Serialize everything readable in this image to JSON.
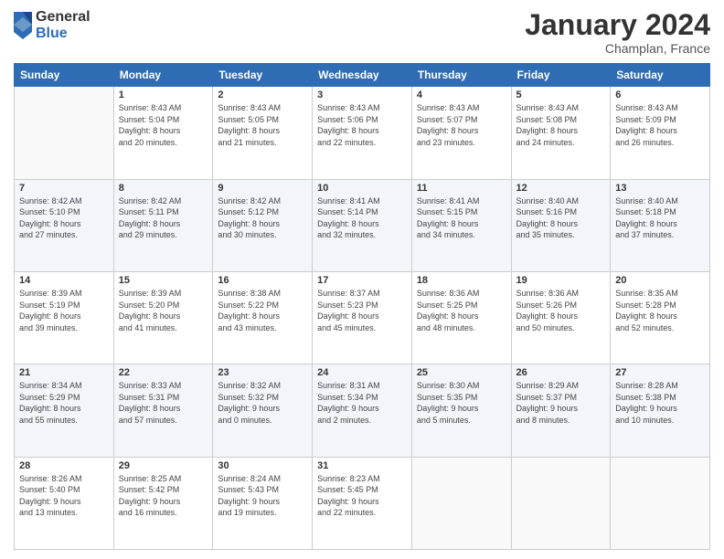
{
  "logo": {
    "general": "General",
    "blue": "Blue"
  },
  "header": {
    "month": "January 2024",
    "location": "Champlan, France"
  },
  "weekdays": [
    "Sunday",
    "Monday",
    "Tuesday",
    "Wednesday",
    "Thursday",
    "Friday",
    "Saturday"
  ],
  "weeks": [
    [
      {
        "day": "",
        "info": ""
      },
      {
        "day": "1",
        "info": "Sunrise: 8:43 AM\nSunset: 5:04 PM\nDaylight: 8 hours\nand 20 minutes."
      },
      {
        "day": "2",
        "info": "Sunrise: 8:43 AM\nSunset: 5:05 PM\nDaylight: 8 hours\nand 21 minutes."
      },
      {
        "day": "3",
        "info": "Sunrise: 8:43 AM\nSunset: 5:06 PM\nDaylight: 8 hours\nand 22 minutes."
      },
      {
        "day": "4",
        "info": "Sunrise: 8:43 AM\nSunset: 5:07 PM\nDaylight: 8 hours\nand 23 minutes."
      },
      {
        "day": "5",
        "info": "Sunrise: 8:43 AM\nSunset: 5:08 PM\nDaylight: 8 hours\nand 24 minutes."
      },
      {
        "day": "6",
        "info": "Sunrise: 8:43 AM\nSunset: 5:09 PM\nDaylight: 8 hours\nand 26 minutes."
      }
    ],
    [
      {
        "day": "7",
        "info": "Sunrise: 8:42 AM\nSunset: 5:10 PM\nDaylight: 8 hours\nand 27 minutes."
      },
      {
        "day": "8",
        "info": "Sunrise: 8:42 AM\nSunset: 5:11 PM\nDaylight: 8 hours\nand 29 minutes."
      },
      {
        "day": "9",
        "info": "Sunrise: 8:42 AM\nSunset: 5:12 PM\nDaylight: 8 hours\nand 30 minutes."
      },
      {
        "day": "10",
        "info": "Sunrise: 8:41 AM\nSunset: 5:14 PM\nDaylight: 8 hours\nand 32 minutes."
      },
      {
        "day": "11",
        "info": "Sunrise: 8:41 AM\nSunset: 5:15 PM\nDaylight: 8 hours\nand 34 minutes."
      },
      {
        "day": "12",
        "info": "Sunrise: 8:40 AM\nSunset: 5:16 PM\nDaylight: 8 hours\nand 35 minutes."
      },
      {
        "day": "13",
        "info": "Sunrise: 8:40 AM\nSunset: 5:18 PM\nDaylight: 8 hours\nand 37 minutes."
      }
    ],
    [
      {
        "day": "14",
        "info": "Sunrise: 8:39 AM\nSunset: 5:19 PM\nDaylight: 8 hours\nand 39 minutes."
      },
      {
        "day": "15",
        "info": "Sunrise: 8:39 AM\nSunset: 5:20 PM\nDaylight: 8 hours\nand 41 minutes."
      },
      {
        "day": "16",
        "info": "Sunrise: 8:38 AM\nSunset: 5:22 PM\nDaylight: 8 hours\nand 43 minutes."
      },
      {
        "day": "17",
        "info": "Sunrise: 8:37 AM\nSunset: 5:23 PM\nDaylight: 8 hours\nand 45 minutes."
      },
      {
        "day": "18",
        "info": "Sunrise: 8:36 AM\nSunset: 5:25 PM\nDaylight: 8 hours\nand 48 minutes."
      },
      {
        "day": "19",
        "info": "Sunrise: 8:36 AM\nSunset: 5:26 PM\nDaylight: 8 hours\nand 50 minutes."
      },
      {
        "day": "20",
        "info": "Sunrise: 8:35 AM\nSunset: 5:28 PM\nDaylight: 8 hours\nand 52 minutes."
      }
    ],
    [
      {
        "day": "21",
        "info": "Sunrise: 8:34 AM\nSunset: 5:29 PM\nDaylight: 8 hours\nand 55 minutes."
      },
      {
        "day": "22",
        "info": "Sunrise: 8:33 AM\nSunset: 5:31 PM\nDaylight: 8 hours\nand 57 minutes."
      },
      {
        "day": "23",
        "info": "Sunrise: 8:32 AM\nSunset: 5:32 PM\nDaylight: 9 hours\nand 0 minutes."
      },
      {
        "day": "24",
        "info": "Sunrise: 8:31 AM\nSunset: 5:34 PM\nDaylight: 9 hours\nand 2 minutes."
      },
      {
        "day": "25",
        "info": "Sunrise: 8:30 AM\nSunset: 5:35 PM\nDaylight: 9 hours\nand 5 minutes."
      },
      {
        "day": "26",
        "info": "Sunrise: 8:29 AM\nSunset: 5:37 PM\nDaylight: 9 hours\nand 8 minutes."
      },
      {
        "day": "27",
        "info": "Sunrise: 8:28 AM\nSunset: 5:38 PM\nDaylight: 9 hours\nand 10 minutes."
      }
    ],
    [
      {
        "day": "28",
        "info": "Sunrise: 8:26 AM\nSunset: 5:40 PM\nDaylight: 9 hours\nand 13 minutes."
      },
      {
        "day": "29",
        "info": "Sunrise: 8:25 AM\nSunset: 5:42 PM\nDaylight: 9 hours\nand 16 minutes."
      },
      {
        "day": "30",
        "info": "Sunrise: 8:24 AM\nSunset: 5:43 PM\nDaylight: 9 hours\nand 19 minutes."
      },
      {
        "day": "31",
        "info": "Sunrise: 8:23 AM\nSunset: 5:45 PM\nDaylight: 9 hours\nand 22 minutes."
      },
      {
        "day": "",
        "info": ""
      },
      {
        "day": "",
        "info": ""
      },
      {
        "day": "",
        "info": ""
      }
    ]
  ]
}
